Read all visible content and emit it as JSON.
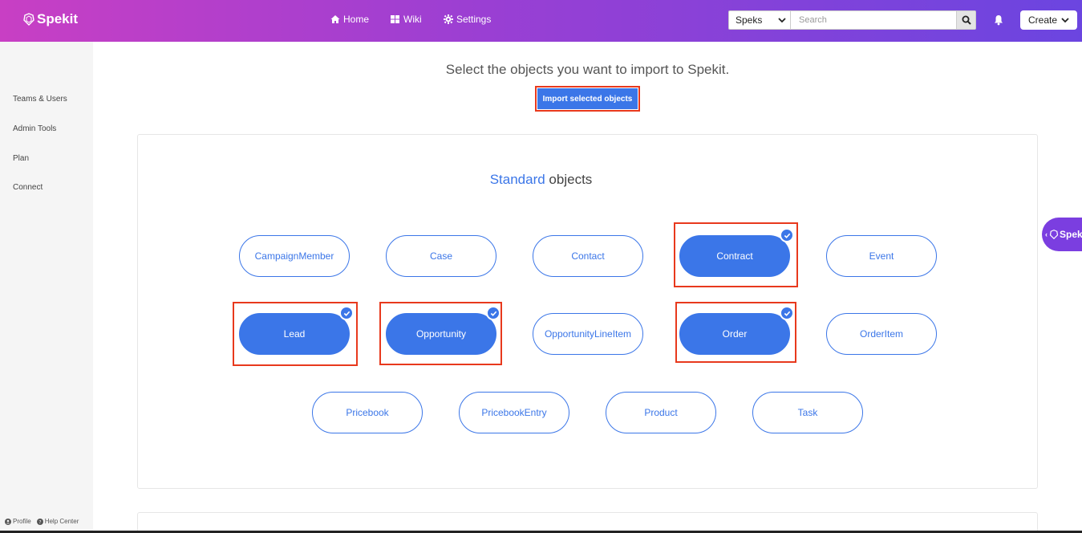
{
  "app": {
    "name": "Spekit"
  },
  "nav": {
    "home": "Home",
    "wiki": "Wiki",
    "settings": "Settings"
  },
  "search": {
    "scope": "Speks",
    "placeholder": "Search"
  },
  "create_label": "Create",
  "sidebar": {
    "items": [
      {
        "label": "Teams & Users"
      },
      {
        "label": "Admin Tools"
      },
      {
        "label": "Plan"
      },
      {
        "label": "Connect"
      }
    ],
    "footer": {
      "profile": "Profile",
      "help": "Help Center"
    }
  },
  "main": {
    "heading": "Select the objects you want to import to Spekit.",
    "import_button": "Import selected objects",
    "section": {
      "accent": "Standard",
      "rest": " objects"
    },
    "objects": [
      {
        "label": "CampaignMember",
        "selected": false
      },
      {
        "label": "Case",
        "selected": false
      },
      {
        "label": "Contact",
        "selected": false
      },
      {
        "label": "Contract",
        "selected": true
      },
      {
        "label": "Event",
        "selected": false
      },
      {
        "label": "Lead",
        "selected": true
      },
      {
        "label": "Opportunity",
        "selected": true
      },
      {
        "label": "OpportunityLineItem",
        "selected": false
      },
      {
        "label": "Order",
        "selected": true
      },
      {
        "label": "OrderItem",
        "selected": false
      },
      {
        "label": "Pricebook",
        "selected": false
      },
      {
        "label": "PricebookEntry",
        "selected": false
      },
      {
        "label": "Product",
        "selected": false
      },
      {
        "label": "Task",
        "selected": false
      }
    ]
  },
  "floating_tab": {
    "label": "Spek"
  },
  "colors": {
    "accent": "#3b76e8",
    "highlight": "#e8391d",
    "nav_start": "#c83fc4",
    "nav_end": "#6b45e0"
  }
}
